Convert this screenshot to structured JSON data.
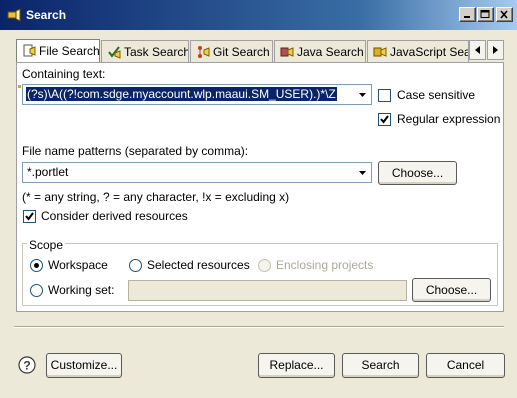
{
  "window": {
    "title": "Search",
    "icon": "search-flashlight-icon"
  },
  "tabs": [
    {
      "label": "File Search",
      "icon": "file-search-icon",
      "active": true
    },
    {
      "label": "Task Search",
      "icon": "task-search-icon",
      "active": false
    },
    {
      "label": "Git Search",
      "icon": "git-search-icon",
      "active": false
    },
    {
      "label": "Java Search",
      "icon": "java-search-icon",
      "active": false
    },
    {
      "label": "JavaScript Sea",
      "icon": "javascript-search-icon",
      "active": false
    }
  ],
  "containing_text": {
    "label": "Containing text:",
    "value": "(?s)\\A((?!com.sdge.myaccount.wlp.maaui.SM_USER).)*\\Z",
    "case_sensitive_label": "Case sensitive",
    "case_sensitive": false,
    "regex_label": "Regular expression",
    "regex": true
  },
  "file_patterns": {
    "label": "File name patterns (separated by comma):",
    "value": "*.portlet",
    "choose_label": "Choose...",
    "hint": "(* = any string, ? = any character, !x = excluding x)",
    "derived_label": "Consider derived resources",
    "derived": true
  },
  "scope": {
    "label": "Scope",
    "workspace_label": "Workspace",
    "selected_resources_label": "Selected resources",
    "enclosing_projects_label": "Enclosing projects",
    "working_set_label": "Working set:",
    "working_set_value": "",
    "choose_label": "Choose...",
    "selected": "Workspace"
  },
  "footer": {
    "help_icon": "help-question-icon",
    "customize_label": "Customize...",
    "replace_label": "Replace...",
    "search_label": "Search",
    "cancel_label": "Cancel"
  },
  "colors": {
    "titlebar_start": "#0a246a",
    "titlebar_end": "#a6caf0",
    "dialog_bg": "#ece9d8",
    "selection": "#0a246a"
  }
}
